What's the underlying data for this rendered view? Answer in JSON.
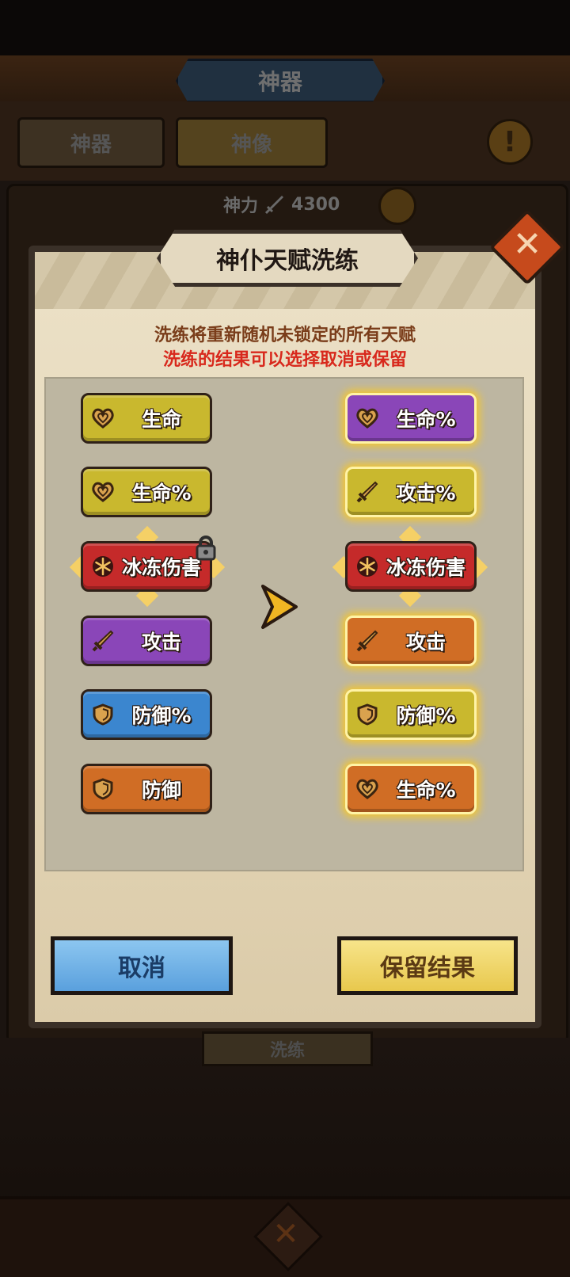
{
  "background": {
    "screen_title": "神器",
    "tabs": [
      "神器",
      "神像"
    ],
    "info_icon": "exclamation-icon",
    "power_label": "神力",
    "power_value": "4300",
    "wash_button": "洗练"
  },
  "dialog": {
    "title": "神仆天赋洗练",
    "description_line1": "洗练将重新随机未锁定的所有天赋",
    "description_line2": "洗练的结果可以选择取消或保留",
    "current_talents": [
      {
        "label": "生命",
        "icon": "heart-icon",
        "color": "#c9b82e",
        "locked": false
      },
      {
        "label": "生命%",
        "icon": "heart-icon",
        "color": "#c9b82e",
        "locked": false
      },
      {
        "label": "冰冻伤害",
        "icon": "snowflake-icon",
        "color": "#c52a2a",
        "locked": true
      },
      {
        "label": "攻击",
        "icon": "sword-icon",
        "color": "#8a46b8",
        "locked": false
      },
      {
        "label": "防御%",
        "icon": "shield-icon",
        "color": "#3b86cf",
        "locked": false
      },
      {
        "label": "防御",
        "icon": "shield-icon",
        "color": "#d06d25",
        "locked": false
      }
    ],
    "new_talents": [
      {
        "label": "生命%",
        "icon": "heart-icon",
        "color": "#8a46b8"
      },
      {
        "label": "攻击%",
        "icon": "sword-icon",
        "color": "#c9b82e"
      },
      {
        "label": "冰冻伤害",
        "icon": "snowflake-icon",
        "color": "#c52a2a"
      },
      {
        "label": "攻击",
        "icon": "sword-icon",
        "color": "#d06d25"
      },
      {
        "label": "防御%",
        "icon": "shield-icon",
        "color": "#c9b82e"
      },
      {
        "label": "生命%",
        "icon": "heart-icon",
        "color": "#d06d25"
      }
    ],
    "cancel_button": "取消",
    "keep_button": "保留结果"
  },
  "colors": {
    "accent_red_text": "#d8281c",
    "description_text": "#7a3d1a"
  }
}
